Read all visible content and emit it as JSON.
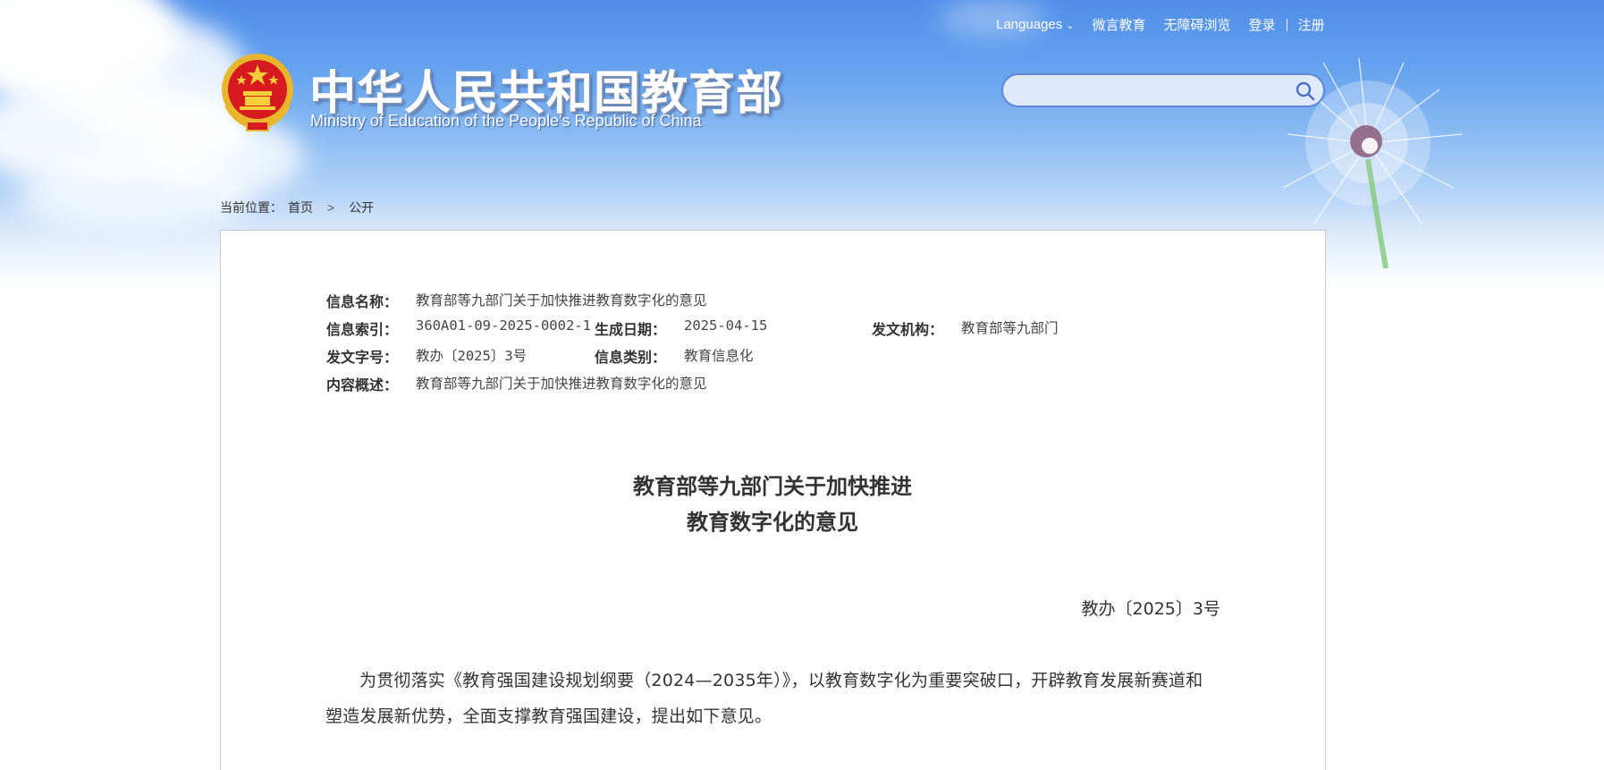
{
  "header": {
    "top_links": {
      "languages": "Languages",
      "weiyan": "微言教育",
      "accessibility": "无障碍浏览",
      "login": "登录",
      "register": "注册"
    },
    "logo": {
      "name_cn": "中华人民共和国教育部",
      "name_en": "Ministry of Education of the People's Republic of China"
    },
    "search": {
      "value": ""
    }
  },
  "breadcrumb": {
    "label": "当前位置：",
    "home": "首页",
    "separator": ">",
    "current": "公开"
  },
  "info": {
    "name_label": "信息名称：",
    "name_value": "教育部等九部门关于加快推进教育数字化的意见",
    "index_label": "信息索引：",
    "index_value": "360A01-09-2025-0002-1",
    "date_label": "生成日期：",
    "date_value": "2025-04-15",
    "org_label": "发文机构：",
    "org_value": "教育部等九部门",
    "docno_label": "发文字号：",
    "docno_value": "教办〔2025〕3号",
    "category_label": "信息类别：",
    "category_value": "教育信息化",
    "summary_label": "内容概述：",
    "summary_value": "教育部等九部门关于加快推进教育数字化的意见"
  },
  "article": {
    "title_line1": "教育部等九部门关于加快推进",
    "title_line2": "教育数字化的意见",
    "doc_number": "教办〔2025〕3号",
    "paragraph1": "为贯彻落实《教育强国建设规划纲要（2024—2035年）》，以教育数字化为重要突破口，开辟教育发展新赛道和塑造发展新优势，全面支撑教育强国建设，提出如下意见。"
  },
  "colors": {
    "sky_top": "#4f8ee9",
    "search_border": "#5f85d6",
    "panel_border": "#c9c9c9",
    "text": "#333333"
  },
  "icons": {
    "emblem": "national-emblem-icon",
    "search": "search-icon",
    "languages_dropdown": "chevron-down-icon",
    "breadcrumb_separator": "chevron-right-icon"
  }
}
